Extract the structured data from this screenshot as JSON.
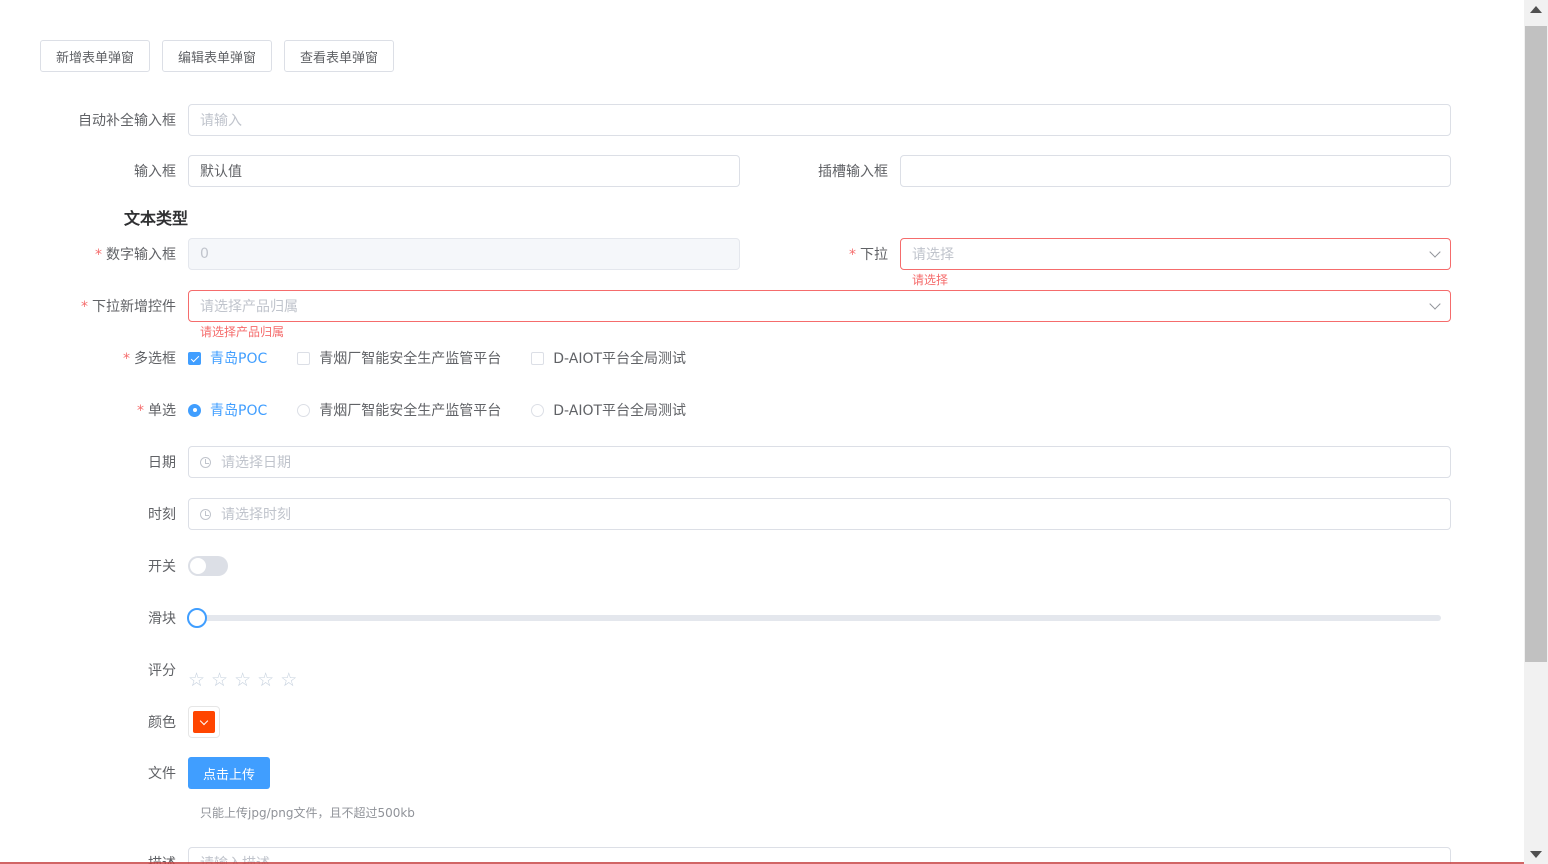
{
  "toolbar": {
    "add_label": "新增表单弹窗",
    "edit_label": "编辑表单弹窗",
    "view_label": "查看表单弹窗"
  },
  "form": {
    "autocomplete": {
      "label": "自动补全输入框",
      "placeholder": "请输入"
    },
    "input": {
      "label": "输入框",
      "value": "默认值"
    },
    "slot_input": {
      "label": "插槽输入框",
      "value": ""
    },
    "section_title": "文本类型",
    "number": {
      "label": "数字输入框",
      "value": "0",
      "required": "*"
    },
    "select": {
      "label": "下拉",
      "placeholder": "请选择",
      "error": "请选择",
      "required": "*"
    },
    "select_add": {
      "label": "下拉新增控件",
      "placeholder": "请选择产品归属",
      "error": "请选择产品归属",
      "required": "*"
    },
    "checkbox": {
      "label": "多选框",
      "required": "*",
      "options": [
        "青岛POC",
        "青烟厂智能安全生产监管平台",
        "D-AIOT平台全局测试"
      ],
      "checked": [
        true,
        false,
        false
      ]
    },
    "radio": {
      "label": "单选",
      "required": "*",
      "options": [
        "青岛POC",
        "青烟厂智能安全生产监管平台",
        "D-AIOT平台全局测试"
      ],
      "selected": 0
    },
    "date": {
      "label": "日期",
      "placeholder": "请选择日期"
    },
    "time": {
      "label": "时刻",
      "placeholder": "请选择时刻"
    },
    "switch": {
      "label": "开关",
      "on": false
    },
    "slider": {
      "label": "滑块",
      "value": 0
    },
    "rate": {
      "label": "评分",
      "value": 0,
      "max": 5
    },
    "color": {
      "label": "颜色",
      "value": "#ff4500"
    },
    "file": {
      "label": "文件",
      "button": "点击上传",
      "tip": "只能上传jpg/png文件，且不超过500kb"
    },
    "desc": {
      "label": "描述",
      "placeholder": "请输入描述"
    }
  },
  "colors": {
    "primary": "#409eff",
    "error": "#f56c6c",
    "color_value": "#ff4500"
  }
}
